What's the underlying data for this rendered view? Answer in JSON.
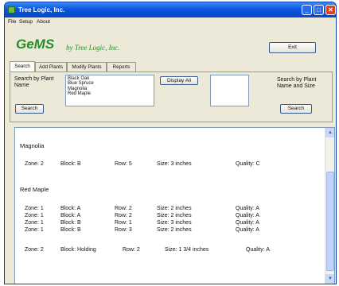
{
  "window": {
    "title": "Tree Logic, Inc."
  },
  "menu": [
    "File",
    "Setup",
    "About"
  ],
  "logo": {
    "name": "GeMS",
    "tagline": "by Tree Logic, Inc."
  },
  "exit_label": "Exit",
  "tabs": [
    "Search",
    "Add Plants",
    "Modify Plants",
    "Reports"
  ],
  "search_by_name": {
    "label": "Search by Plant Name",
    "button": "Search",
    "plants": [
      "Black Oak",
      "Blue Spruce",
      "Magnolia",
      "Red Maple"
    ]
  },
  "display_all_label": "Display All",
  "search_by_name_size": {
    "label": "Search by Plant Name and Size",
    "button": "Search",
    "value": ""
  },
  "results": {
    "groups": [
      {
        "name": "Magnolia",
        "rows": [
          {
            "zone": "Zone: 2",
            "block": "Block: B",
            "row": "Row: 5",
            "size": "Size: 3 inches",
            "quality": "Quality: C"
          }
        ]
      },
      {
        "name": "Red Maple",
        "rows": [
          {
            "zone": "Zone: 1",
            "block": "Block: A",
            "row": "Row: 2",
            "size": "Size: 2 inches",
            "quality": "Quality: A"
          },
          {
            "zone": "Zone: 1",
            "block": "Block: A",
            "row": "Row: 2",
            "size": "Size: 2 inches",
            "quality": "Quality: A"
          },
          {
            "zone": "Zone: 1",
            "block": "Block: B",
            "row": "Row: 1",
            "size": "Size: 3 inches",
            "quality": "Quality: A"
          },
          {
            "zone": "Zone: 1",
            "block": "Block: B",
            "row": "Row: 3",
            "size": "Size: 2 inches",
            "quality": "Quality: A"
          },
          {
            "zone": "Zone: 2",
            "block": "Block: Holding",
            "row": "Row: 2",
            "size": "Size: 1 3/4 inches",
            "quality": "Quality: A"
          }
        ]
      }
    ]
  }
}
